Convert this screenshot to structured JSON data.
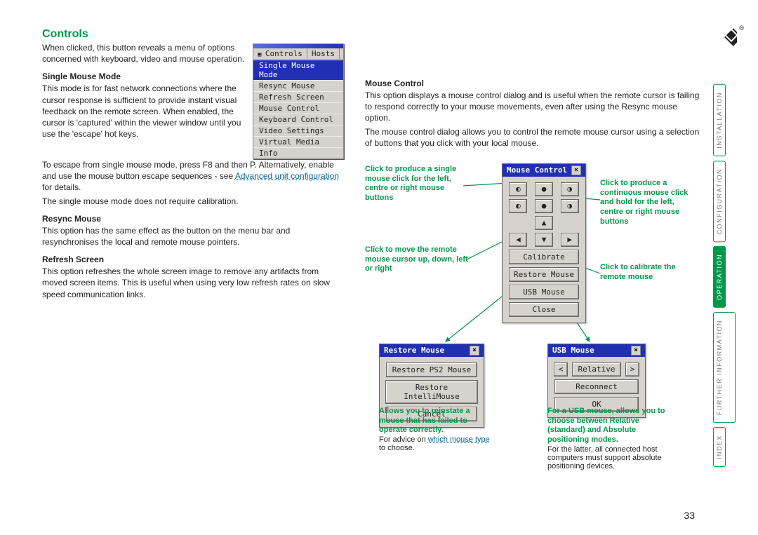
{
  "heading": "Controls",
  "intro": "When clicked, this button reveals a menu of options concerned with keyboard, video and mouse operation.",
  "smm": {
    "title": "Single Mouse Mode",
    "p1": "This mode is for fast network connections where the cursor response is sufficient to provide instant visual feedback on the remote screen. When enabled, the cursor is 'captured' within the viewer window until you use the 'escape' hot keys.",
    "p2a": "To escape from single mouse mode, press F8 and then P. Alternatively, enable and use the mouse button escape sequences - see ",
    "p2link": "Advanced unit configuration",
    "p2b": " for details.",
    "p3": "The single mouse mode does not require calibration."
  },
  "resync": {
    "title": "Resync Mouse",
    "p": "This option has the same effect as the button on the menu bar and resynchronises the local and remote mouse pointers."
  },
  "refresh": {
    "title": "Refresh Screen",
    "p": "This option refreshes the whole screen image to remove any artifacts from moved screen items. This is useful when using very low refresh rates on slow speed communication links."
  },
  "rightHeading": "Mouse Control",
  "rightP1": "This option displays a mouse control dialog and is useful when the remote cursor is failing to respond correctly to your mouse movements, even after using the Resync mouse option.",
  "rightP2": "The mouse control dialog allows you to control the remote mouse cursor using a selection of buttons that you click with your local mouse.",
  "controlsMenu": {
    "tab1": "Controls",
    "tab2": "Hosts",
    "items": [
      "Single Mouse Mode",
      "Resync Mouse",
      "Refresh Screen",
      "Mouse Control",
      "Keyboard Control",
      "Video Settings",
      "Virtual Media",
      "Info"
    ]
  },
  "mouseDialog": {
    "title": "Mouse Control",
    "btns": {
      "calibrate": "Calibrate",
      "restore": "Restore Mouse",
      "usb": "USB Mouse",
      "close": "Close"
    }
  },
  "restoreDialog": {
    "title": "Restore Mouse",
    "b1": "Restore PS2 Mouse",
    "b2": "Restore IntelliMouse",
    "b3": "Cancel"
  },
  "usbDialog": {
    "title": "USB Mouse",
    "mode": "Relative",
    "reconnect": "Reconnect",
    "ok": "OK"
  },
  "callouts": {
    "single": "Click to produce a single mouse click for the left, centre or right mouse buttons",
    "hold": "Click to produce a continuous mouse click and hold for the left, centre or right mouse buttons",
    "move": "Click to move the remote mouse cursor up, down, left or right",
    "calib": "Click to calibrate the remote mouse",
    "restore": "Allows you to reinstate a mouse that has failed to operate correctly.",
    "restoreAdvice": "For advice on ",
    "restoreLink": "which mouse type",
    "restoreAdvice2": " to choose.",
    "usb": "For a USB mouse, allows you to choose between Relative (standard) and Absolute positioning modes.",
    "usb2": "For the latter, all connected host computers must support absolute positioning devices."
  },
  "sidenav": {
    "installation": "INSTALLATION",
    "configuration": "CONFIGURATION",
    "operation": "OPERATION",
    "further": "FURTHER INFORMATION",
    "index": "INDEX"
  },
  "pageNumber": "33"
}
